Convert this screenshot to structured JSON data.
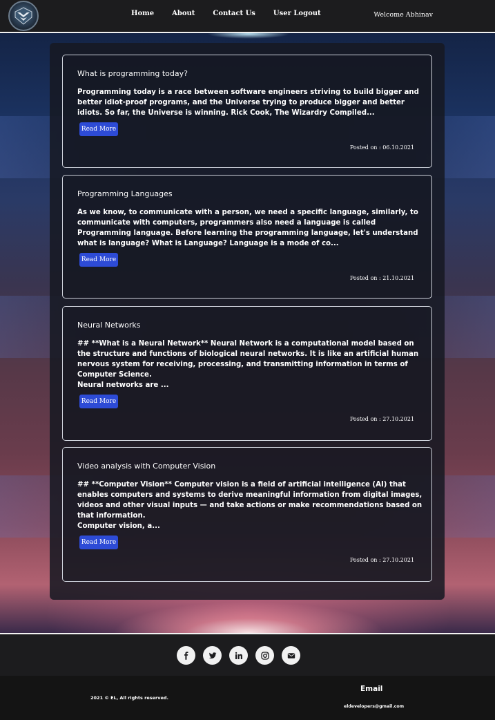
{
  "nav": {
    "logo_icon": "shield-eagle-logo",
    "links": [
      {
        "label": "Home"
      },
      {
        "label": "About"
      },
      {
        "label": "Contact Us"
      },
      {
        "label": "User Logout"
      }
    ],
    "welcome": "Welcome Abhinav"
  },
  "posts": [
    {
      "title": "What is programming today?",
      "body": "Programming today is a race between software engineers striving to build bigger and better idiot-proof programs, and the Universe trying to produce bigger and better idiots. So far, the Universe is winning. Rick Cook, The Wizardry Compiled...",
      "button": "Read More",
      "posted": "Posted on : 06.10.2021"
    },
    {
      "title": "Programming Languages",
      "body": "As we know, to communicate with a person, we need a specific language, similarly, to communicate with computers, programmers also need a language is called Programming language. Before learning the programming language, let's understand what is language? What is Language? Language is a mode of co...",
      "button": "Read More",
      "posted": "Posted on : 21.10.2021"
    },
    {
      "title": "Neural Networks",
      "body": "## **What is a Neural Network** Neural Network is a computational model based on the structure and functions of biological neural networks. It is like an artificial human nervous system for receiving, processing, and transmitting information in terms of Computer Science.\nNeural networks are ...",
      "button": "Read More",
      "posted": "Posted on : 27.10.2021"
    },
    {
      "title": "Video analysis with Computer Vision",
      "body": "## **Computer Vision** Computer vision is a field of artificial intelligence (AI) that enables computers and systems to derive meaningful information from digital images, videos and other visual inputs — and take actions or make recommendations based on that information.\nComputer vision, a...",
      "button": "Read More",
      "posted": "Posted on : 27.10.2021"
    }
  ],
  "footer": {
    "social": [
      {
        "icon": "facebook-icon"
      },
      {
        "icon": "twitter-icon"
      },
      {
        "icon": "linkedin-icon"
      },
      {
        "icon": "instagram-icon"
      },
      {
        "icon": "envelope-icon"
      }
    ],
    "copyright": "2021 © EL, All rights reserved.",
    "email_heading": "Email",
    "email": "eldevelopers@gmail.com"
  },
  "colors": {
    "accent": "#2d4bd6",
    "navbar": "#1c1c1e"
  }
}
